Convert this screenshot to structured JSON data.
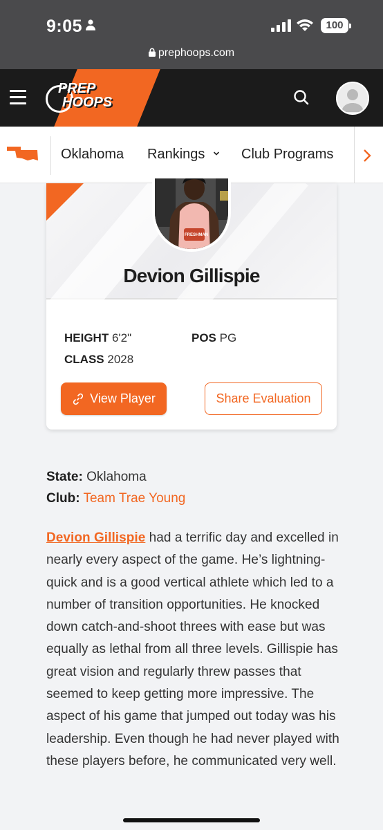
{
  "status_bar": {
    "time": "9:05",
    "battery": "100"
  },
  "browser": {
    "url": "prephoops.com"
  },
  "header": {
    "logo_line1": "PREP",
    "logo_line2": "HOOPS"
  },
  "nav": {
    "items": [
      "Oklahoma",
      "Rankings",
      "Club Programs"
    ]
  },
  "player": {
    "name": "Devion Gillispie",
    "height_label": "HEIGHT",
    "height_value": "6'2\"",
    "pos_label": "POS",
    "pos_value": "PG",
    "class_label": "CLASS",
    "class_value": "2028",
    "view_button": "View Player",
    "share_button": "Share Evaluation",
    "jersey_text": "FRESHMAN"
  },
  "details": {
    "state_label": "State:",
    "state_value": "Oklahoma",
    "club_label": "Club:",
    "club_value": "Team Trae Young"
  },
  "article": {
    "link_name": "Devion Gillispie",
    "body": " had a terrific day and excelled in nearly every aspect of the game. He’s lightning-quick and is a good vertical athlete which led to a number of transition opportunities. He knocked down catch-and-shoot threes with ease but was equally as lethal from all three levels. Gillispie has great vision and regularly threw passes that seemed to keep getting more impressive. The aspect of his game that jumped out today was his leadership. Even though he had never played with these players before, he communicated very well."
  },
  "colors": {
    "accent": "#f26722",
    "header_bg": "#1b1b1b"
  },
  "icons": [
    "person-icon",
    "signal-icon",
    "wifi-icon",
    "lock-icon",
    "menu-icon",
    "search-icon",
    "user-avatar-icon",
    "oklahoma-state-icon",
    "chevron-down-icon",
    "chevron-right-icon",
    "link-icon"
  ]
}
